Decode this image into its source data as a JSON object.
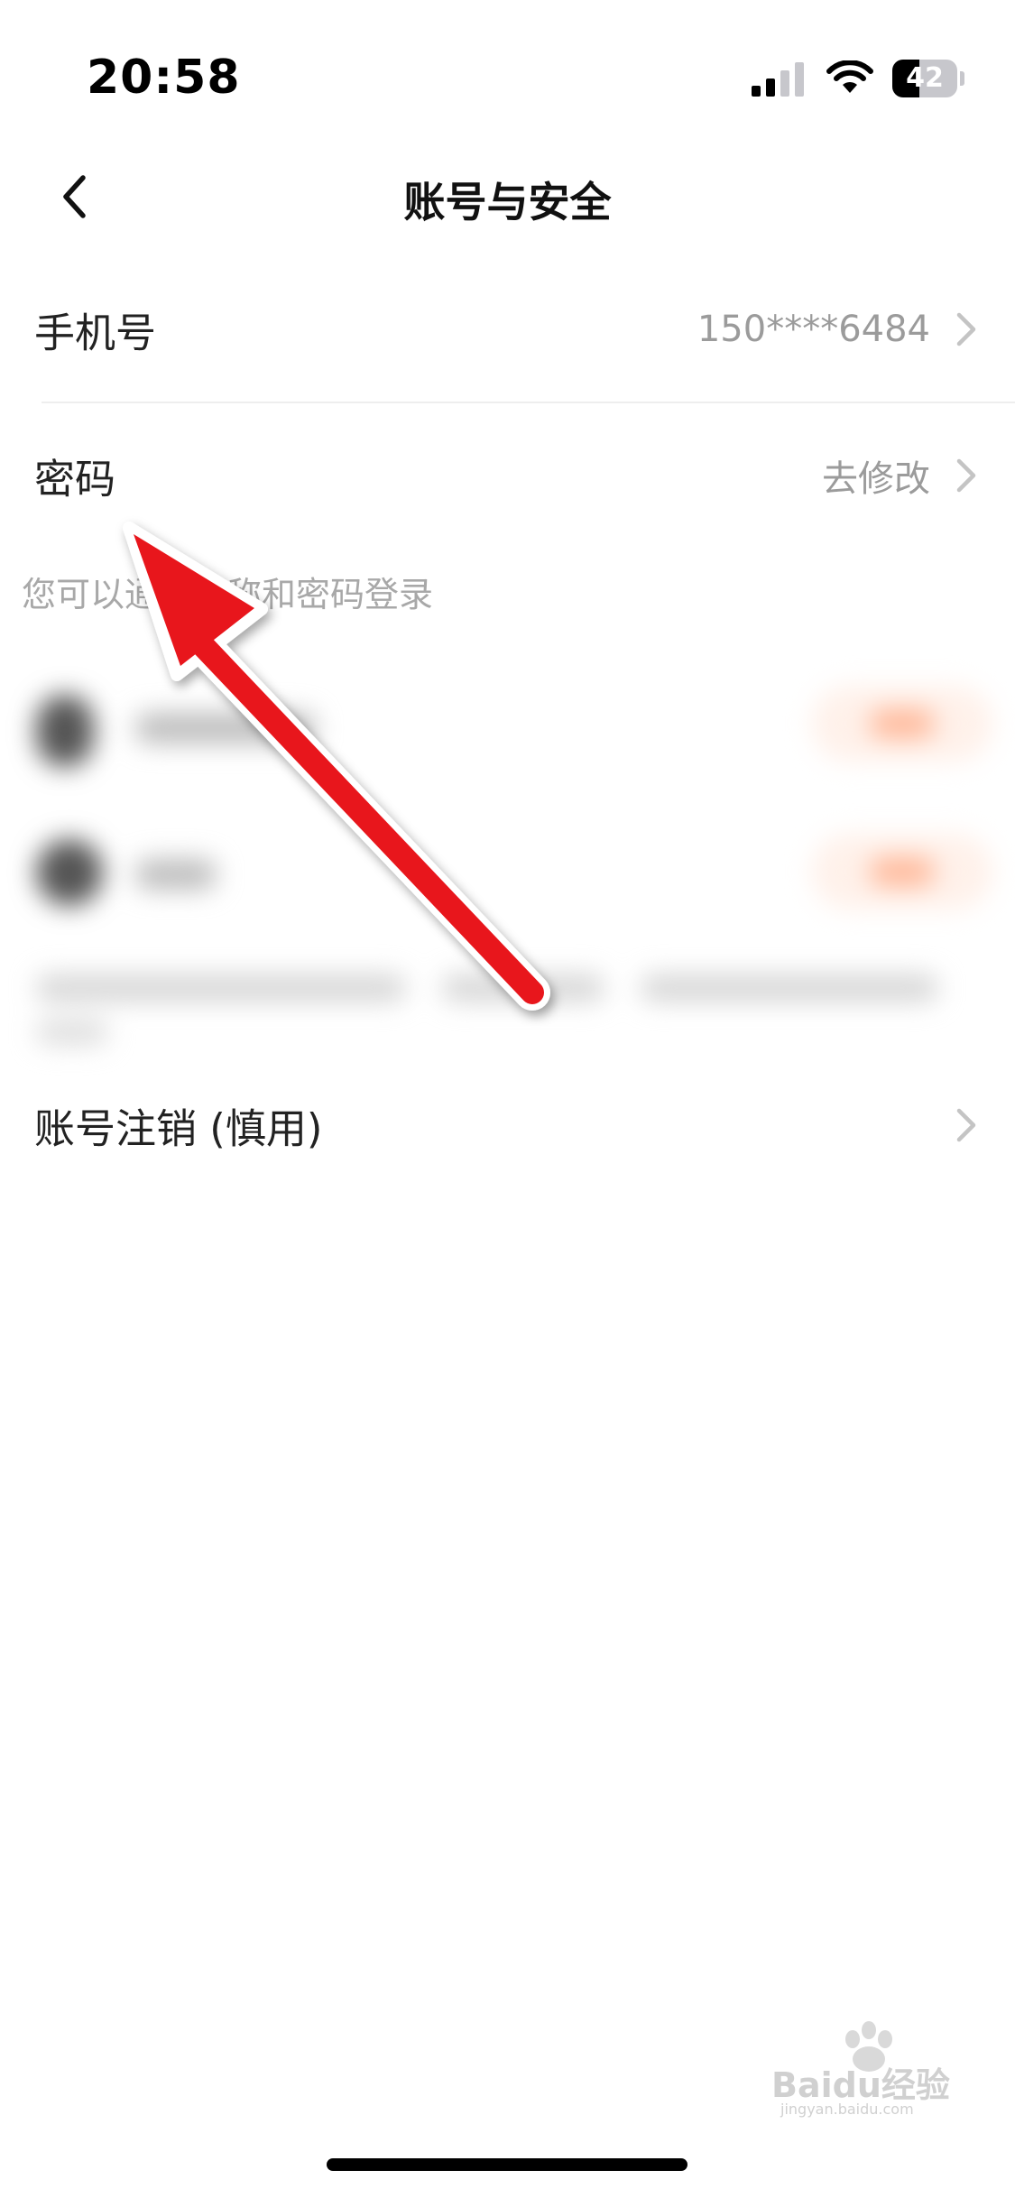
{
  "status_bar": {
    "time": "20:58",
    "battery_text": "42",
    "battery_level": 0.42,
    "icons": [
      "signal-icon",
      "wifi-icon",
      "battery-icon"
    ]
  },
  "nav": {
    "back_icon": "chevron-left-icon",
    "title": "账号与安全"
  },
  "rows": {
    "phone": {
      "label": "手机号",
      "value": "150****6484"
    },
    "password": {
      "label": "密码",
      "value": "去修改"
    },
    "deactivate": {
      "label": "账号注销 (慎用)"
    }
  },
  "hint": "您可以通过昵称和密码登录",
  "colors": {
    "annotation_arrow": "#e8141c",
    "chevron": "#c4c4c4",
    "secondary_text": "#9b9b9b"
  },
  "watermark": {
    "brand": "Baidu经验",
    "site": "jingyan.baidu.com"
  }
}
